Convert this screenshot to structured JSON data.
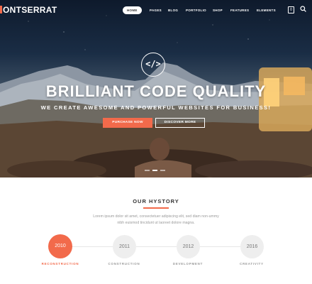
{
  "brand": {
    "logo_text": "ONTSERRAT",
    "accent_color": "#f26a4b"
  },
  "nav": {
    "items": [
      "HOME",
      "PAGES",
      "BLOG",
      "PORTFOLIO",
      "SHOP",
      "FEATURES",
      "ELEMENTS"
    ],
    "active": "HOME",
    "cart_count": "0",
    "icons": [
      "shopping-bag-icon",
      "menu-search-icon"
    ]
  },
  "hero": {
    "icon": "code-icon",
    "icon_glyph": "</>",
    "title": "BRILLIANT CODE QUALITY",
    "subtitle": "WE CREATE AWESOME AND POWERFUL WEBSITES FOR BUSINESS!",
    "primary_button": "PURCHASE NOW",
    "secondary_button": "DISCOVER MORE",
    "slider_total": 3,
    "slider_active": 2
  },
  "history": {
    "title": "OUR HYSTORY",
    "text": "Lorem ipsum dolor sit amet, consectetuer adipiscing elit, sed diam non-ummy nibh euismod tincidunt ut laoreet dolore magna.",
    "timeline": [
      {
        "year": "2010",
        "label": "RECONSTRUCTION",
        "active": true
      },
      {
        "year": "2011",
        "label": "CONSTRUCTION",
        "active": false
      },
      {
        "year": "2012",
        "label": "DEVELOPMENT",
        "active": false
      },
      {
        "year": "2016",
        "label": "CREATIVITY",
        "active": false
      }
    ]
  }
}
